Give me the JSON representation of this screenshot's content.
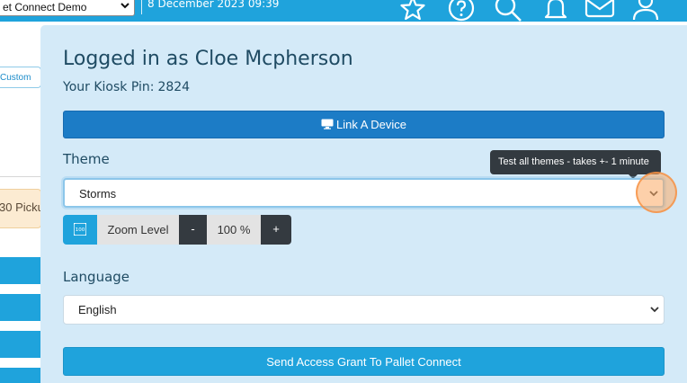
{
  "header": {
    "site_select_value": "et Connect Demo",
    "datetime": "8 December 2023 09:39",
    "icons": [
      "star-icon",
      "help-icon",
      "search-icon",
      "bell-icon",
      "mail-icon",
      "user-icon"
    ]
  },
  "background": {
    "link_text": "Custom",
    "pickup_text": "30 Picku"
  },
  "modal": {
    "title": "Logged in as Cloe Mcpherson",
    "kiosk_pin_label": "Your Kiosk Pin:",
    "kiosk_pin_value": "2824",
    "link_device_button": "Link A Device",
    "theme_label": "Theme",
    "theme_value": "Storms",
    "theme_tooltip": "Test all themes - takes +- 1 minute",
    "zoom_icon_text": "100",
    "zoom_label": "Zoom Level",
    "zoom_minus": "-",
    "zoom_value": "100 %",
    "zoom_plus": "+",
    "language_label": "Language",
    "language_value": "English",
    "grant_button": "Send Access Grant To Pallet Connect"
  },
  "colors": {
    "brand_blue": "#1fa3dc",
    "button_dark_blue": "#1c7cc6",
    "modal_bg": "#d4eaf8",
    "dark_button": "#343a40",
    "title_text": "#1f4b63"
  }
}
